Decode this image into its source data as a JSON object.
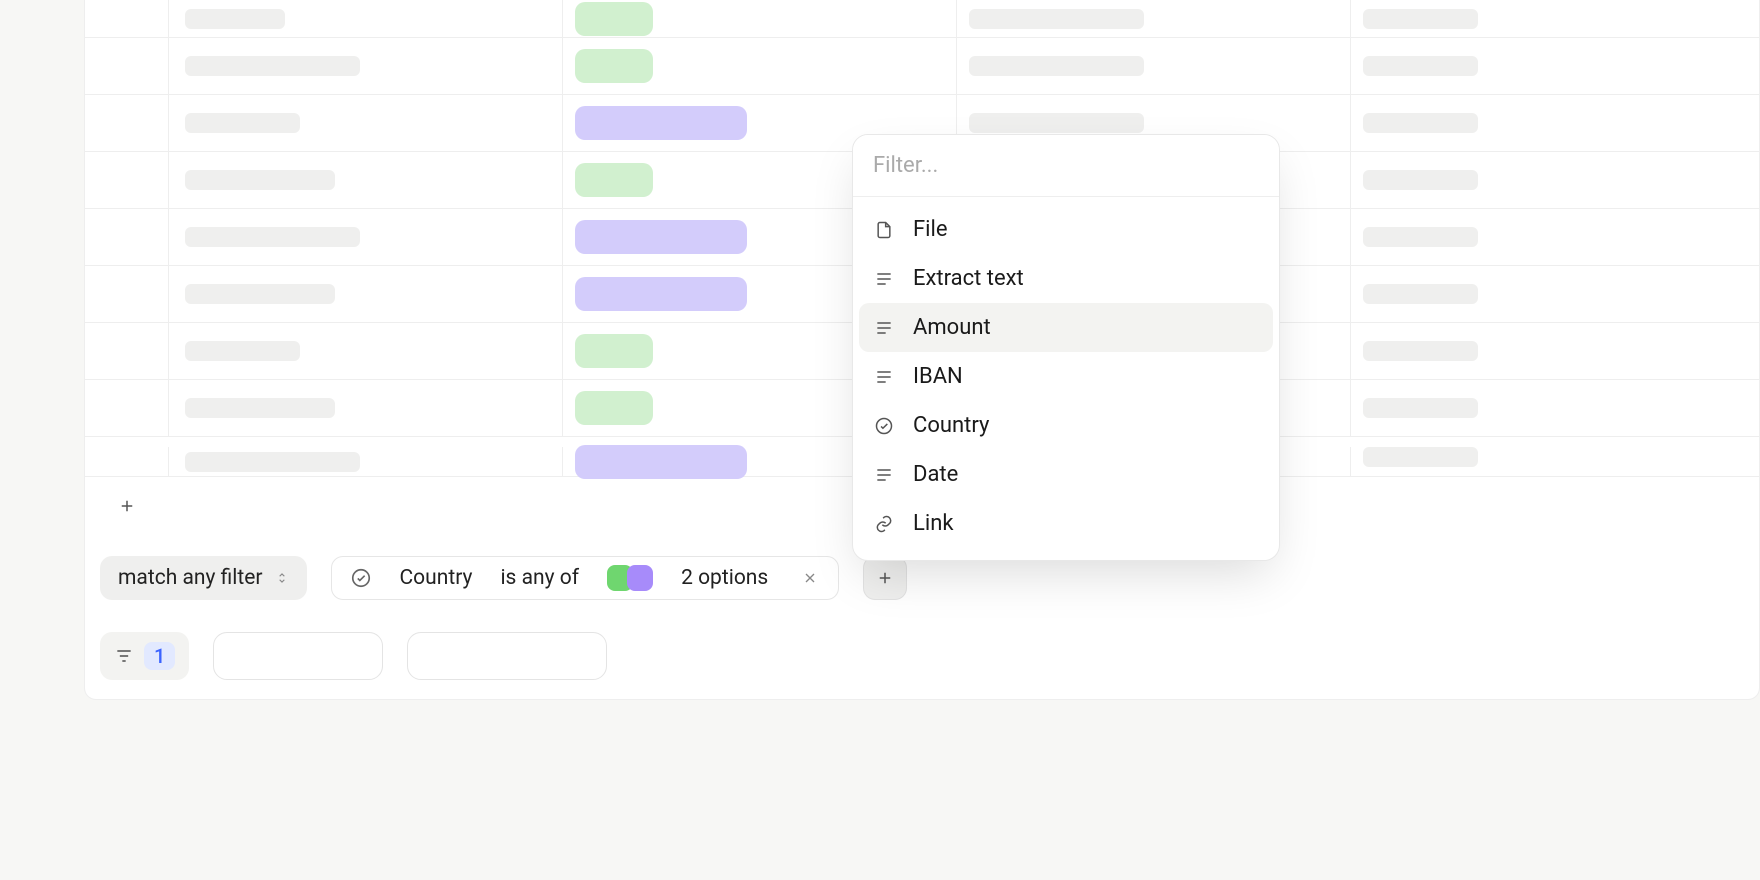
{
  "table": {
    "rows": [
      {
        "text_w": "w4",
        "pill": "green",
        "pill_w": "green"
      },
      {
        "text_w": "w3",
        "pill": "green",
        "pill_w": "green"
      },
      {
        "text_w": "w2",
        "pill": "purple",
        "pill_w": "purple"
      },
      {
        "text_w": "w1",
        "pill": "green",
        "pill_w": "green"
      },
      {
        "text_w": "w3",
        "pill": "purple",
        "pill_w": "purple"
      },
      {
        "text_w": "w1",
        "pill": "purple",
        "pill_w": "purple"
      },
      {
        "text_w": "w2",
        "pill": "green",
        "pill_w": "green"
      },
      {
        "text_w": "w1",
        "pill": "green",
        "pill_w": "green"
      },
      {
        "text_w": "w3",
        "pill": "purple",
        "pill_w": "purple"
      }
    ]
  },
  "filter_bar": {
    "match_mode": "match any filter",
    "active_filter": {
      "field": "Country",
      "condition": "is any of",
      "value_summary": "2 options"
    }
  },
  "bottom_bar": {
    "active_filter_count": "1"
  },
  "popover": {
    "search_placeholder": "Filter...",
    "items": [
      {
        "icon": "file",
        "label": "File"
      },
      {
        "icon": "text",
        "label": "Extract text"
      },
      {
        "icon": "text",
        "label": "Amount",
        "hover": true
      },
      {
        "icon": "text",
        "label": "IBAN"
      },
      {
        "icon": "check",
        "label": "Country"
      },
      {
        "icon": "text",
        "label": "Date"
      },
      {
        "icon": "link",
        "label": "Link"
      }
    ]
  }
}
